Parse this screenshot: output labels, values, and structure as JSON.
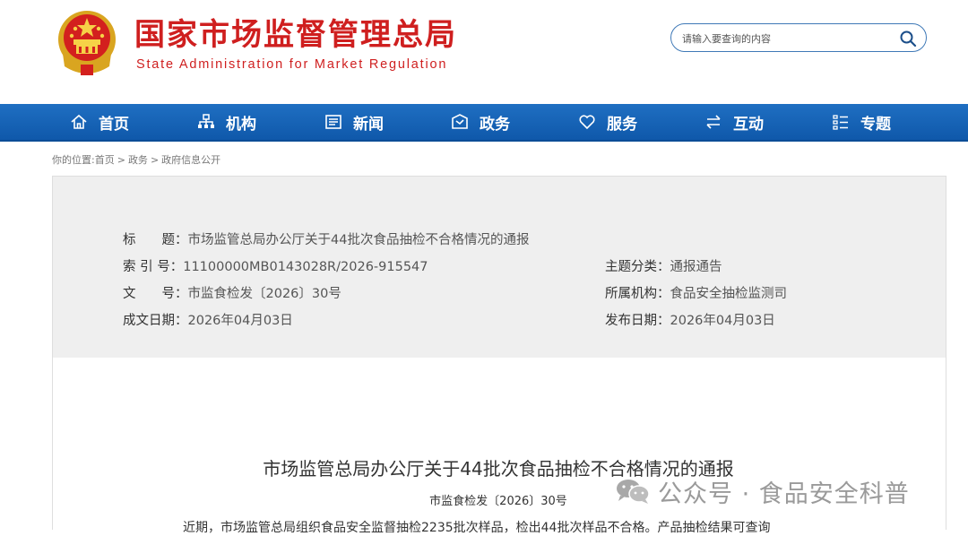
{
  "header": {
    "site_title": "国家市场监督管理总局",
    "site_subtitle": "State Administration for Market Regulation",
    "search_placeholder": "请输入要查询的内容"
  },
  "nav": {
    "items": [
      {
        "label": "首页",
        "icon": "home-icon"
      },
      {
        "label": "机构",
        "icon": "org-chart-icon"
      },
      {
        "label": "新闻",
        "icon": "newspaper-icon"
      },
      {
        "label": "政务",
        "icon": "government-icon"
      },
      {
        "label": "服务",
        "icon": "heart-icon"
      },
      {
        "label": "互动",
        "icon": "exchange-arrows-icon"
      },
      {
        "label": "专题",
        "icon": "list-icon"
      }
    ]
  },
  "breadcrumb": {
    "prefix": "你的位置:",
    "items": [
      "首页",
      "政务",
      "政府信息公开"
    ]
  },
  "meta": {
    "title_label": "标　　题：",
    "title_value": "市场监管总局办公厅关于44批次食品抽检不合格情况的通报",
    "index_label": "索 引 号：",
    "index_value": "11100000MB0143028R/2026-915547",
    "category_label": "主题分类：",
    "category_value": "通报通告",
    "docno_label": "文　　号：",
    "docno_value": "市监食检发〔2026〕30号",
    "agency_label": "所属机构：",
    "agency_value": "食品安全抽检监测司",
    "created_label": "成文日期：",
    "created_value": "2026年04月03日",
    "published_label": "发布日期：",
    "published_value": "2026年04月03日"
  },
  "document": {
    "title": "市场监管总局办公厅关于44批次食品抽检不合格情况的通报",
    "number": "市监食检发〔2026〕30号",
    "body_first_line": "近期，市场监管总局组织食品安全监督抽检2235批次样品，检出44批次样品不合格。产品抽检结果可查询"
  },
  "watermark": {
    "text": "公众号 · 食品安全科普"
  },
  "colors": {
    "brand_red": "#cf1f1f",
    "nav_blue": "#1565bd",
    "meta_bg": "#efefef"
  }
}
